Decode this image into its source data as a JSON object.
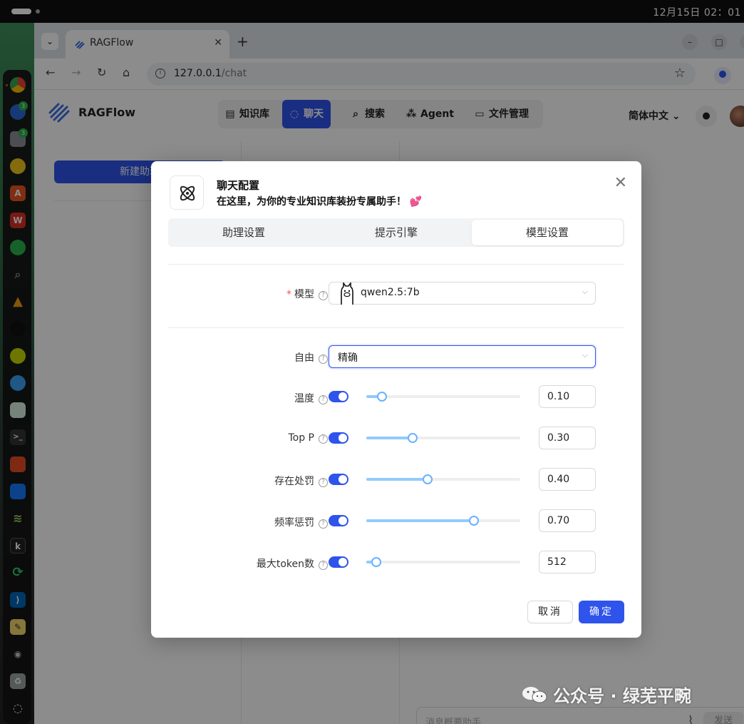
{
  "system": {
    "clock": "12月15日  02：01"
  },
  "dock": {
    "badges": [
      "3",
      "3"
    ]
  },
  "browser": {
    "tab_title": "RAGFlow",
    "url_host": "127.0.0.1",
    "url_path": "/chat"
  },
  "app": {
    "brand": "RAGFlow",
    "nav": [
      {
        "label": "知识库"
      },
      {
        "label": "聊天"
      },
      {
        "label": "搜索"
      },
      {
        "label": "Agent"
      },
      {
        "label": "文件管理"
      }
    ],
    "language": "简体中文",
    "new_assistant_button": "新建助理",
    "composer_placeholder": "消息概要助手",
    "composer_send": "发送"
  },
  "modal": {
    "title": "聊天配置",
    "subtitle": "在这里，为你的专业知识库装扮专属助手！ 💕",
    "tabs": [
      "助理设置",
      "提示引擎",
      "模型设置"
    ],
    "active_tab": 2,
    "model": {
      "label": "模型",
      "value": "qwen2.5:7b"
    },
    "freedom": {
      "label": "自由",
      "value": "精确"
    },
    "params": [
      {
        "label": "温度",
        "value": "0.10",
        "level": 0.1
      },
      {
        "label": "Top P",
        "value": "0.30",
        "level": 0.3
      },
      {
        "label": "存在处罚",
        "value": "0.40",
        "level": 0.4
      },
      {
        "label": "频率惩罚",
        "value": "0.70",
        "level": 0.7
      },
      {
        "label": "最大token数",
        "value": "512",
        "level": 0.0625
      }
    ],
    "cancel_label": "取消",
    "ok_label": "确定"
  },
  "watermark": "公众号 · 绿芜平畹",
  "colors": {
    "primary": "#2f54eb",
    "slider_fill": "#91caff",
    "required": "#ff4d4f"
  }
}
